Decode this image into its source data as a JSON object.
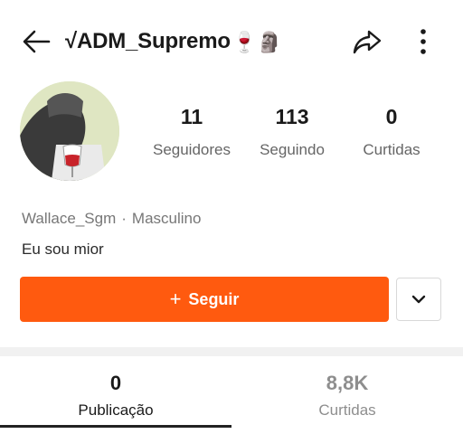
{
  "header": {
    "title": "√ADM_Supremo",
    "title_emojis": "🍷🗿",
    "back_icon": "arrow-left-icon",
    "share_icon": "share-icon",
    "more_icon": "more-vertical-icon"
  },
  "profile": {
    "stats": [
      {
        "value": "11",
        "label": "Seguidores"
      },
      {
        "value": "113",
        "label": "Seguindo"
      },
      {
        "value": "0",
        "label": "Curtidas"
      }
    ],
    "username": "Wallace_Sgm",
    "separator": "·",
    "gender": "Masculino",
    "bio": "Eu sou mior"
  },
  "actions": {
    "follow_label": "Seguir",
    "follow_icon": "+",
    "dropdown_icon": "chevron-down-icon"
  },
  "tabs": [
    {
      "count": "0",
      "label": "Publicação",
      "active": true
    },
    {
      "count": "8,8K",
      "label": "Curtidas",
      "active": false
    }
  ],
  "colors": {
    "accent": "#ff5a0f",
    "text": "#1a1a1a",
    "muted": "#777777"
  }
}
